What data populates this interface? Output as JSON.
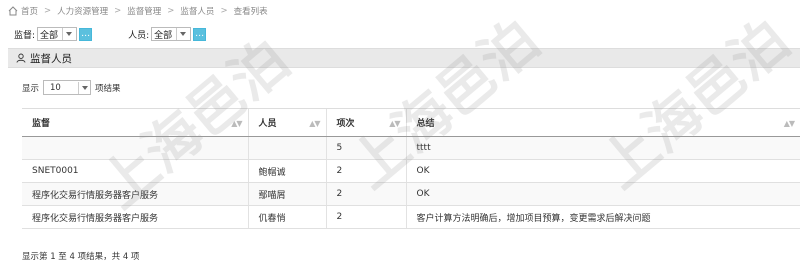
{
  "breadcrumb": [
    "首页",
    "人力资源管理",
    "监督管理",
    "监督人员",
    "查看列表"
  ],
  "filters": {
    "supervisor": {
      "label": "监督:",
      "value": "全部"
    },
    "person": {
      "label": "人员:",
      "value": "全部"
    }
  },
  "panel": {
    "title": "监督人员"
  },
  "length": {
    "prefix": "显示",
    "value": "10",
    "suffix": "项结果"
  },
  "table": {
    "headers": [
      "监督",
      "人员",
      "项次",
      "总结"
    ],
    "rows": [
      [
        "",
        "",
        "5",
        "tttt"
      ],
      [
        "SNET0001",
        "鲍帽诚",
        "2",
        "OK"
      ],
      [
        "程序化交易行情服务器客户服务",
        "鄢喵屑",
        "2",
        "OK"
      ],
      [
        "程序化交易行情服务器客户服务",
        "仉春悄",
        "2",
        "客户计算方法明确后，增加项目预算，变更需求后解决问题"
      ]
    ]
  },
  "info": "显示第 1 至 4 项结果，共 4 项",
  "watermark": "上海邑泊"
}
